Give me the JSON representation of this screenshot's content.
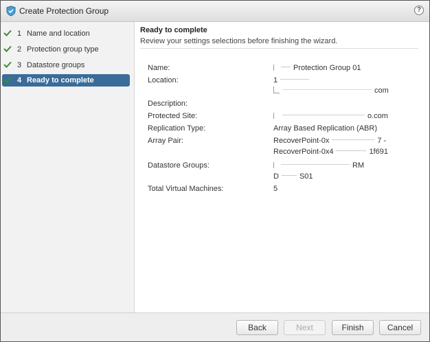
{
  "window": {
    "title": "Create Protection Group",
    "help_label": "?"
  },
  "steps": [
    {
      "number": "1",
      "label": "Name and location",
      "completed": true,
      "active": false
    },
    {
      "number": "2",
      "label": "Protection group type",
      "completed": true,
      "active": false
    },
    {
      "number": "3",
      "label": "Datastore groups",
      "completed": true,
      "active": false
    },
    {
      "number": "4",
      "label": "Ready to complete",
      "completed": true,
      "active": true
    }
  ],
  "page": {
    "heading": "Ready to complete",
    "subheading": "Review your settings selections before finishing the wizard."
  },
  "summary": {
    "name_label": "Name:",
    "name_value": "Protection Group 01",
    "location_label": "Location:",
    "location_value_1": "1",
    "location_value_2": "com",
    "description_label": "Description:",
    "protected_site_label": "Protected Site:",
    "protected_site_value": "o.com",
    "replication_type_label": "Replication Type:",
    "replication_type_value": "Array Based Replication (ABR)",
    "array_pair_label": "Array Pair:",
    "array_pair_value_1": "RecoverPoint-0x",
    "array_pair_value_1_tail": "7 -",
    "array_pair_value_2": "RecoverPoint-0x4",
    "array_pair_value_2_tail": "1f691",
    "datastore_groups_label": "Datastore Groups:",
    "datastore_groups_value_1": "RM",
    "datastore_groups_value_2": "D",
    "datastore_groups_value_2_tail": "S01",
    "total_vms_label": "Total Virtual Machines:",
    "total_vms_value": "5"
  },
  "buttons": {
    "back": "Back",
    "next": "Next",
    "finish": "Finish",
    "cancel": "Cancel"
  },
  "colors": {
    "active_step": "#3a6c99",
    "check": "#3d8b2f",
    "shield": "#4a9fd4"
  }
}
